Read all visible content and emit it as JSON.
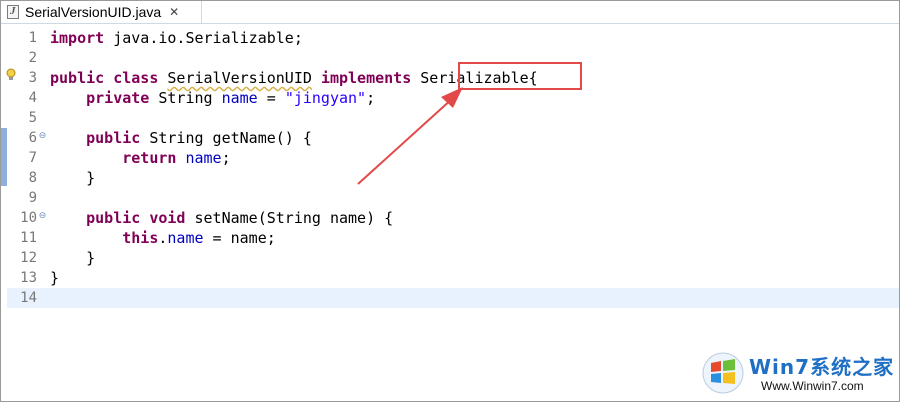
{
  "tab": {
    "title": "SerialVersionUID.java",
    "close_glyph": "✕",
    "icon_letter": "J"
  },
  "lines": [
    {
      "num": "1",
      "tokens": [
        {
          "t": "import",
          "c": "kw"
        },
        {
          "t": " java.io.Serializable;",
          "c": ""
        }
      ]
    },
    {
      "num": "2",
      "tokens": []
    },
    {
      "num": "3",
      "tokens": [
        {
          "t": "public",
          "c": "kw"
        },
        {
          "t": " ",
          "c": ""
        },
        {
          "t": "class",
          "c": "kw"
        },
        {
          "t": " ",
          "c": ""
        },
        {
          "t": "SerialVersionUID",
          "c": "warn"
        },
        {
          "t": " ",
          "c": ""
        },
        {
          "t": "implements",
          "c": "kw"
        },
        {
          "t": " Serializable{",
          "c": ""
        }
      ]
    },
    {
      "num": "4",
      "tokens": [
        {
          "t": "    ",
          "c": ""
        },
        {
          "t": "private",
          "c": "kw"
        },
        {
          "t": " String ",
          "c": ""
        },
        {
          "t": "name",
          "c": "fld"
        },
        {
          "t": " = ",
          "c": ""
        },
        {
          "t": "\"jingyan\"",
          "c": "str"
        },
        {
          "t": ";",
          "c": ""
        }
      ]
    },
    {
      "num": "5",
      "tokens": []
    },
    {
      "num": "6",
      "fold": "⊖",
      "tokens": [
        {
          "t": "    ",
          "c": ""
        },
        {
          "t": "public",
          "c": "kw"
        },
        {
          "t": " String getName() {",
          "c": ""
        }
      ]
    },
    {
      "num": "7",
      "tokens": [
        {
          "t": "        ",
          "c": ""
        },
        {
          "t": "return",
          "c": "kw"
        },
        {
          "t": " ",
          "c": ""
        },
        {
          "t": "name",
          "c": "fld"
        },
        {
          "t": ";",
          "c": ""
        }
      ]
    },
    {
      "num": "8",
      "tokens": [
        {
          "t": "    }",
          "c": ""
        }
      ]
    },
    {
      "num": "9",
      "tokens": []
    },
    {
      "num": "10",
      "fold": "⊖",
      "tokens": [
        {
          "t": "    ",
          "c": ""
        },
        {
          "t": "public",
          "c": "kw"
        },
        {
          "t": " ",
          "c": ""
        },
        {
          "t": "void",
          "c": "kw"
        },
        {
          "t": " setName(String name) {",
          "c": ""
        }
      ]
    },
    {
      "num": "11",
      "tokens": [
        {
          "t": "        ",
          "c": ""
        },
        {
          "t": "this",
          "c": "kw"
        },
        {
          "t": ".",
          "c": ""
        },
        {
          "t": "name",
          "c": "fld"
        },
        {
          "t": " = name;",
          "c": ""
        }
      ]
    },
    {
      "num": "12",
      "tokens": [
        {
          "t": "    }",
          "c": ""
        }
      ]
    },
    {
      "num": "13",
      "tokens": [
        {
          "t": "}",
          "c": ""
        }
      ]
    },
    {
      "num": "14",
      "tokens": [],
      "current": true
    }
  ],
  "annotation": {
    "color": "#e24a4a"
  },
  "watermark": {
    "brand": "Win7系统之家",
    "url": "Www.Winwin7.com"
  },
  "colors": {
    "keyword": "#7f0055",
    "field": "#0000c0",
    "string": "#2a00ff",
    "current_line": "#e8f2fe"
  }
}
